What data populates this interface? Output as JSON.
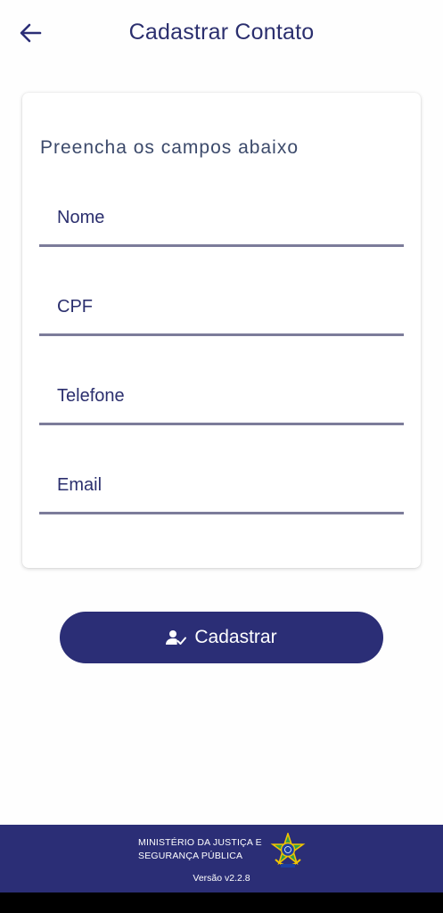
{
  "header": {
    "title": "Cadastrar Contato",
    "back_icon": "arrow-left-icon"
  },
  "form": {
    "heading": "Preencha os campos abaixo",
    "fields": [
      {
        "label": "Nome",
        "value": ""
      },
      {
        "label": "CPF",
        "value": ""
      },
      {
        "label": "Telefone",
        "value": ""
      },
      {
        "label": "Email",
        "value": ""
      }
    ]
  },
  "submit": {
    "label": "Cadastrar",
    "icon": "person-check-icon"
  },
  "footer": {
    "ministry_line1": "MINISTÉRIO DA JUSTIÇA E",
    "ministry_line2": "SEGURANÇA PÚBLICA",
    "version": "Versão v2.2.8",
    "emblem": "brazil-coat-of-arms-icon"
  },
  "colors": {
    "primary": "#2b2e76",
    "text": "#2b2f6e",
    "underline": "#7c7c9a",
    "background": "#fefefe"
  }
}
